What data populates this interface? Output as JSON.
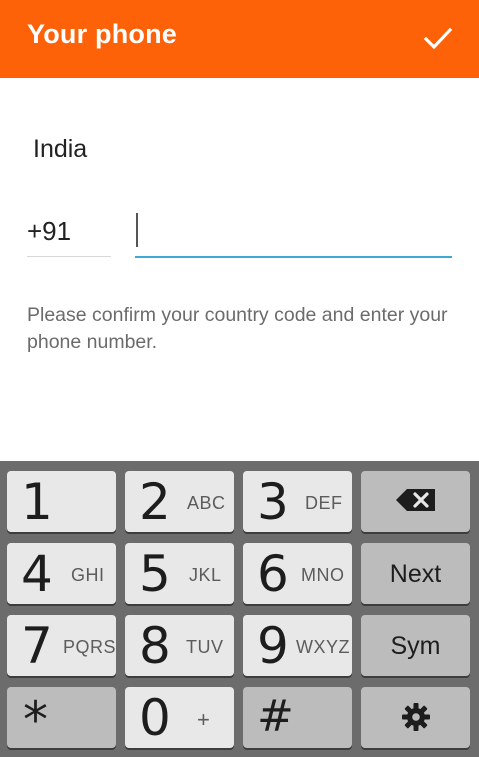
{
  "appbar": {
    "title": "Your phone",
    "confirm_icon": "checkmark-icon",
    "bg_color": "#fd6208"
  },
  "form": {
    "country": "India",
    "country_code": "+91",
    "phone_value": "",
    "hint": "Please confirm your country code and enter your phone number.",
    "accent_color": "#3ea7d6"
  },
  "keyboard": {
    "keys": [
      {
        "digit": "1",
        "letters": ""
      },
      {
        "digit": "2",
        "letters": "ABC"
      },
      {
        "digit": "3",
        "letters": "DEF"
      },
      {
        "icon": "backspace-icon"
      },
      {
        "digit": "4",
        "letters": "GHI"
      },
      {
        "digit": "5",
        "letters": "JKL"
      },
      {
        "digit": "6",
        "letters": "MNO"
      },
      {
        "label": "Next"
      },
      {
        "digit": "7",
        "letters": "PQRS"
      },
      {
        "digit": "8",
        "letters": "TUV"
      },
      {
        "digit": "9",
        "letters": "WXYZ"
      },
      {
        "label": "Sym"
      },
      {
        "digit": "*",
        "letters": ""
      },
      {
        "digit": "0",
        "letters": "+"
      },
      {
        "digit": "#",
        "letters": ""
      },
      {
        "icon": "settings-icon"
      }
    ]
  }
}
